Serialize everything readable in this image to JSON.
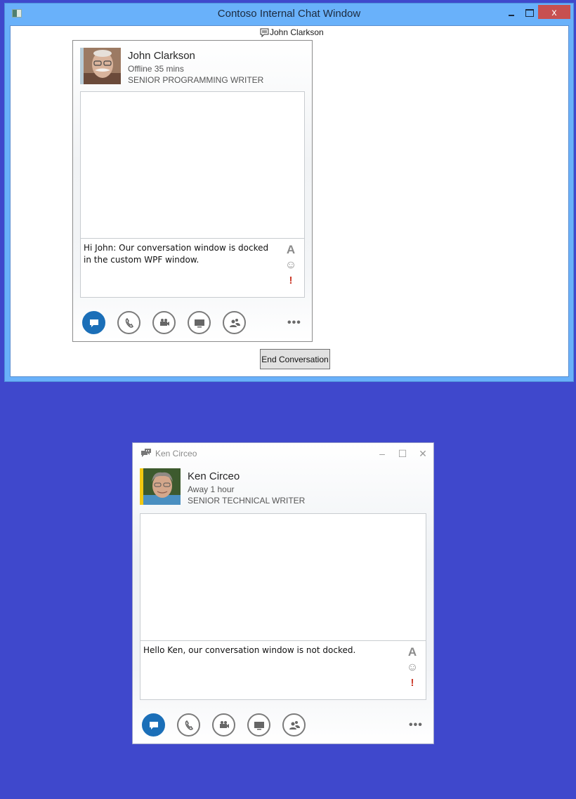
{
  "outer_window": {
    "title": "Contoso Internal Chat Window",
    "close_label": "x",
    "docked_header_label": "John Clarkson",
    "end_button_label": "End Conversation"
  },
  "docked_conversation": {
    "contact": {
      "name": "John Clarkson",
      "status": "Offline 35 mins",
      "job_title": "SENIOR PROGRAMMING WRITER",
      "presence_color": "#b8cbd6"
    },
    "compose_text": "Hi John: Our conversation window is docked in the custom WPF window.",
    "compose_tools": {
      "font": "A",
      "emoji": "☺",
      "important": "!"
    },
    "more_label": "•••"
  },
  "floating_window": {
    "title": "Ken Circeo",
    "contact": {
      "name": "Ken Circeo",
      "status": "Away 1 hour",
      "job_title": "SENIOR TECHNICAL WRITER",
      "presence_color": "#f2c811"
    },
    "compose_text": "Hello Ken, our conversation window is not docked.",
    "compose_tools": {
      "font": "A",
      "emoji": "☺",
      "important": "!"
    },
    "more_label": "•••",
    "minimize_label": "–",
    "maximize_label": "☐",
    "close_label": "✕"
  },
  "colors": {
    "desktop": "#3f48cc",
    "window_frame": "#69b1fa",
    "close_red": "#c75050",
    "im_active": "#1b6fb8",
    "away_yellow": "#f2c811"
  }
}
